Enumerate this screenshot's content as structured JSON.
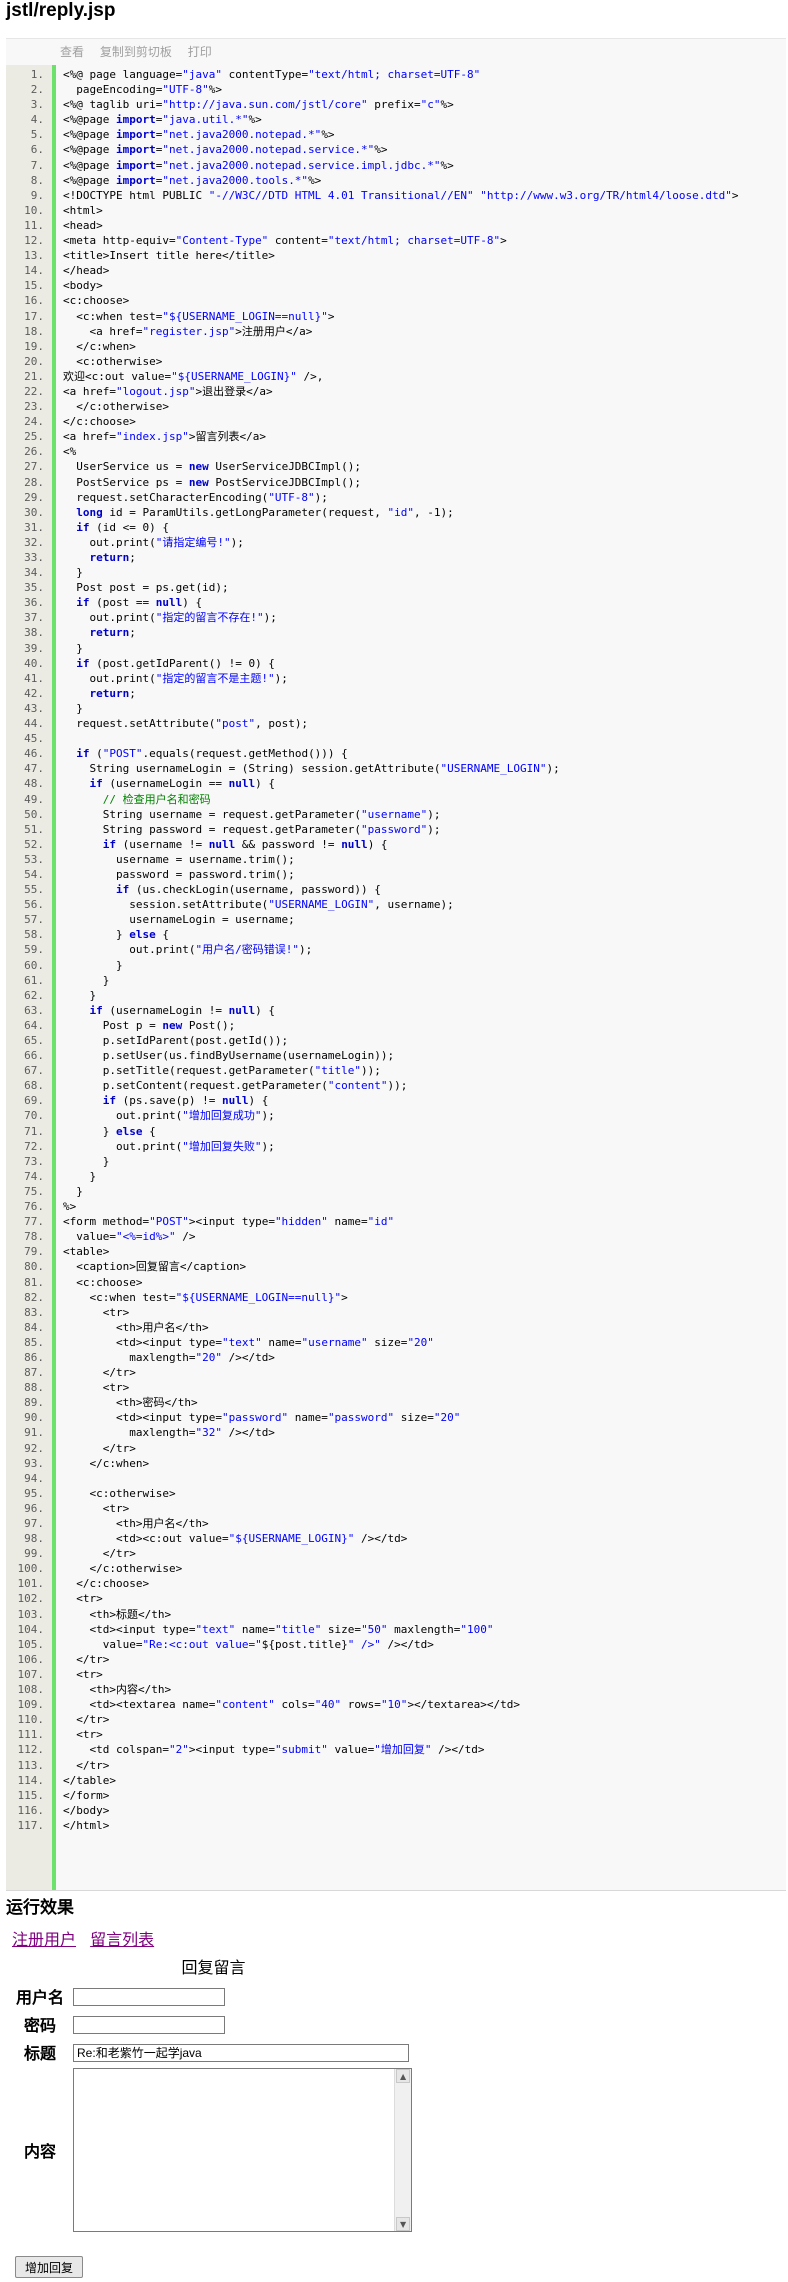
{
  "page_title": "jstl/reply.jsp",
  "toolbar": {
    "view": "查看",
    "copy": "复制到剪切板",
    "print": "打印"
  },
  "code_lines": [
    [
      [
        "t",
        "<%@ page language="
      ],
      [
        "s",
        "\"java\""
      ],
      [
        "t",
        " contentType="
      ],
      [
        "s",
        "\"text/html; charset=UTF-8\""
      ]
    ],
    [
      [
        "t",
        "  pageEncoding="
      ],
      [
        "s",
        "\"UTF-8\""
      ],
      [
        "t",
        "%>"
      ]
    ],
    [
      [
        "t",
        "<%@ taglib uri="
      ],
      [
        "s",
        "\"http://java.sun.com/jstl/core\""
      ],
      [
        "t",
        " prefix="
      ],
      [
        "s",
        "\"c\""
      ],
      [
        "t",
        "%>"
      ]
    ],
    [
      [
        "t",
        "<%@page "
      ],
      [
        "k",
        "import"
      ],
      [
        "t",
        "="
      ],
      [
        "s",
        "\"java.util.*\""
      ],
      [
        "t",
        "%>"
      ]
    ],
    [
      [
        "t",
        "<%@page "
      ],
      [
        "k",
        "import"
      ],
      [
        "t",
        "="
      ],
      [
        "s",
        "\"net.java2000.notepad.*\""
      ],
      [
        "t",
        "%>"
      ]
    ],
    [
      [
        "t",
        "<%@page "
      ],
      [
        "k",
        "import"
      ],
      [
        "t",
        "="
      ],
      [
        "s",
        "\"net.java2000.notepad.service.*\""
      ],
      [
        "t",
        "%>"
      ]
    ],
    [
      [
        "t",
        "<%@page "
      ],
      [
        "k",
        "import"
      ],
      [
        "t",
        "="
      ],
      [
        "s",
        "\"net.java2000.notepad.service.impl.jdbc.*\""
      ],
      [
        "t",
        "%>"
      ]
    ],
    [
      [
        "t",
        "<%@page "
      ],
      [
        "k",
        "import"
      ],
      [
        "t",
        "="
      ],
      [
        "s",
        "\"net.java2000.tools.*\""
      ],
      [
        "t",
        "%>"
      ]
    ],
    [
      [
        "t",
        "<!DOCTYPE html PUBLIC "
      ],
      [
        "s",
        "\"-//W3C//DTD HTML 4.01 Transitional//EN\""
      ],
      [
        "t",
        " "
      ],
      [
        "s",
        "\"http://www.w3.org/TR/html4/loose.dtd\""
      ],
      [
        "t",
        ">"
      ]
    ],
    [
      [
        "t",
        "<html>"
      ]
    ],
    [
      [
        "t",
        "<head>"
      ]
    ],
    [
      [
        "t",
        "<meta http-equiv="
      ],
      [
        "s",
        "\"Content-Type\""
      ],
      [
        "t",
        " content="
      ],
      [
        "s",
        "\"text/html; charset=UTF-8\""
      ],
      [
        "t",
        ">"
      ]
    ],
    [
      [
        "t",
        "<title>Insert title here</title>"
      ]
    ],
    [
      [
        "t",
        "</head>"
      ]
    ],
    [
      [
        "t",
        "<body>"
      ]
    ],
    [
      [
        "t",
        "<c:choose>"
      ]
    ],
    [
      [
        "t",
        "  <c:when test="
      ],
      [
        "s",
        "\"${USERNAME_LOGIN==null}\""
      ],
      [
        "t",
        ">"
      ]
    ],
    [
      [
        "t",
        "    <a href="
      ],
      [
        "s",
        "\"register.jsp\""
      ],
      [
        "t",
        ">注册用户</a>"
      ]
    ],
    [
      [
        "t",
        "  </c:when>"
      ]
    ],
    [
      [
        "t",
        "  <c:otherwise>"
      ]
    ],
    [
      [
        "t",
        "欢迎<c:out value="
      ],
      [
        "s",
        "\"${USERNAME_LOGIN}\""
      ],
      [
        "t",
        " />,"
      ]
    ],
    [
      [
        "t",
        "<a href="
      ],
      [
        "s",
        "\"logout.jsp\""
      ],
      [
        "t",
        ">退出登录</a>"
      ]
    ],
    [
      [
        "t",
        "  </c:otherwise>"
      ]
    ],
    [
      [
        "t",
        "</c:choose>"
      ]
    ],
    [
      [
        "t",
        "<a href="
      ],
      [
        "s",
        "\"index.jsp\""
      ],
      [
        "t",
        ">留言列表</a>"
      ]
    ],
    [
      [
        "t",
        "<%"
      ]
    ],
    [
      [
        "t",
        "  UserService us = "
      ],
      [
        "k",
        "new"
      ],
      [
        "t",
        " UserServiceJDBCImpl();"
      ]
    ],
    [
      [
        "t",
        "  PostService ps = "
      ],
      [
        "k",
        "new"
      ],
      [
        "t",
        " PostServiceJDBCImpl();"
      ]
    ],
    [
      [
        "t",
        "  request.setCharacterEncoding("
      ],
      [
        "s",
        "\"UTF-8\""
      ],
      [
        "t",
        ");"
      ]
    ],
    [
      [
        "t",
        "  "
      ],
      [
        "k",
        "long"
      ],
      [
        "t",
        " id = ParamUtils.getLongParameter(request, "
      ],
      [
        "s",
        "\"id\""
      ],
      [
        "t",
        ", -1);"
      ]
    ],
    [
      [
        "t",
        "  "
      ],
      [
        "k",
        "if"
      ],
      [
        "t",
        " (id <= 0) {"
      ]
    ],
    [
      [
        "t",
        "    out.print("
      ],
      [
        "s",
        "\"请指定编号!\""
      ],
      [
        "t",
        ");"
      ]
    ],
    [
      [
        "t",
        "    "
      ],
      [
        "k",
        "return"
      ],
      [
        "t",
        ";"
      ]
    ],
    [
      [
        "t",
        "  }"
      ]
    ],
    [
      [
        "t",
        "  Post post = ps.get(id);"
      ]
    ],
    [
      [
        "t",
        "  "
      ],
      [
        "k",
        "if"
      ],
      [
        "t",
        " (post == "
      ],
      [
        "k",
        "null"
      ],
      [
        "t",
        ") {"
      ]
    ],
    [
      [
        "t",
        "    out.print("
      ],
      [
        "s",
        "\"指定的留言不存在!\""
      ],
      [
        "t",
        ");"
      ]
    ],
    [
      [
        "t",
        "    "
      ],
      [
        "k",
        "return"
      ],
      [
        "t",
        ";"
      ]
    ],
    [
      [
        "t",
        "  }"
      ]
    ],
    [
      [
        "t",
        "  "
      ],
      [
        "k",
        "if"
      ],
      [
        "t",
        " (post.getIdParent() != 0) {"
      ]
    ],
    [
      [
        "t",
        "    out.print("
      ],
      [
        "s",
        "\"指定的留言不是主题!\""
      ],
      [
        "t",
        ");"
      ]
    ],
    [
      [
        "t",
        "    "
      ],
      [
        "k",
        "return"
      ],
      [
        "t",
        ";"
      ]
    ],
    [
      [
        "t",
        "  }"
      ]
    ],
    [
      [
        "t",
        "  request.setAttribute("
      ],
      [
        "s",
        "\"post\""
      ],
      [
        "t",
        ", post);"
      ]
    ],
    [
      [
        "t",
        ""
      ]
    ],
    [
      [
        "t",
        "  "
      ],
      [
        "k",
        "if"
      ],
      [
        "t",
        " ("
      ],
      [
        "s",
        "\"POST\""
      ],
      [
        "t",
        ".equals(request.getMethod())) {"
      ]
    ],
    [
      [
        "t",
        "    String usernameLogin = (String) session.getAttribute("
      ],
      [
        "s",
        "\"USERNAME_LOGIN\""
      ],
      [
        "t",
        ");"
      ]
    ],
    [
      [
        "t",
        "    "
      ],
      [
        "k",
        "if"
      ],
      [
        "t",
        " (usernameLogin == "
      ],
      [
        "k",
        "null"
      ],
      [
        "t",
        ") {"
      ]
    ],
    [
      [
        "t",
        "      "
      ],
      [
        "c",
        "// 检查用户名和密码"
      ]
    ],
    [
      [
        "t",
        "      String username = request.getParameter("
      ],
      [
        "s",
        "\"username\""
      ],
      [
        "t",
        ");"
      ]
    ],
    [
      [
        "t",
        "      String password = request.getParameter("
      ],
      [
        "s",
        "\"password\""
      ],
      [
        "t",
        ");"
      ]
    ],
    [
      [
        "t",
        "      "
      ],
      [
        "k",
        "if"
      ],
      [
        "t",
        " (username != "
      ],
      [
        "k",
        "null"
      ],
      [
        "t",
        " && password != "
      ],
      [
        "k",
        "null"
      ],
      [
        "t",
        ") {"
      ]
    ],
    [
      [
        "t",
        "        username = username.trim();"
      ]
    ],
    [
      [
        "t",
        "        password = password.trim();"
      ]
    ],
    [
      [
        "t",
        "        "
      ],
      [
        "k",
        "if"
      ],
      [
        "t",
        " (us.checkLogin(username, password)) {"
      ]
    ],
    [
      [
        "t",
        "          session.setAttribute("
      ],
      [
        "s",
        "\"USERNAME_LOGIN\""
      ],
      [
        "t",
        ", username);"
      ]
    ],
    [
      [
        "t",
        "          usernameLogin = username;"
      ]
    ],
    [
      [
        "t",
        "        } "
      ],
      [
        "k",
        "else"
      ],
      [
        "t",
        " {"
      ]
    ],
    [
      [
        "t",
        "          out.print("
      ],
      [
        "s",
        "\"用户名/密码错误!\""
      ],
      [
        "t",
        ");"
      ]
    ],
    [
      [
        "t",
        "        }"
      ]
    ],
    [
      [
        "t",
        "      }"
      ]
    ],
    [
      [
        "t",
        "    }"
      ]
    ],
    [
      [
        "t",
        "    "
      ],
      [
        "k",
        "if"
      ],
      [
        "t",
        " (usernameLogin != "
      ],
      [
        "k",
        "null"
      ],
      [
        "t",
        ") {"
      ]
    ],
    [
      [
        "t",
        "      Post p = "
      ],
      [
        "k",
        "new"
      ],
      [
        "t",
        " Post();"
      ]
    ],
    [
      [
        "t",
        "      p.setIdParent(post.getId());"
      ]
    ],
    [
      [
        "t",
        "      p.setUser(us.findByUsername(usernameLogin));"
      ]
    ],
    [
      [
        "t",
        "      p.setTitle(request.getParameter("
      ],
      [
        "s",
        "\"title\""
      ],
      [
        "t",
        "));"
      ]
    ],
    [
      [
        "t",
        "      p.setContent(request.getParameter("
      ],
      [
        "s",
        "\"content\""
      ],
      [
        "t",
        "));"
      ]
    ],
    [
      [
        "t",
        "      "
      ],
      [
        "k",
        "if"
      ],
      [
        "t",
        " (ps.save(p) != "
      ],
      [
        "k",
        "null"
      ],
      [
        "t",
        ") {"
      ]
    ],
    [
      [
        "t",
        "        out.print("
      ],
      [
        "s",
        "\"增加回复成功\""
      ],
      [
        "t",
        ");"
      ]
    ],
    [
      [
        "t",
        "      } "
      ],
      [
        "k",
        "else"
      ],
      [
        "t",
        " {"
      ]
    ],
    [
      [
        "t",
        "        out.print("
      ],
      [
        "s",
        "\"增加回复失败\""
      ],
      [
        "t",
        ");"
      ]
    ],
    [
      [
        "t",
        "      }"
      ]
    ],
    [
      [
        "t",
        "    }"
      ]
    ],
    [
      [
        "t",
        "  }"
      ]
    ],
    [
      [
        "t",
        "%>"
      ]
    ],
    [
      [
        "t",
        "<form method="
      ],
      [
        "s",
        "\"POST\""
      ],
      [
        "t",
        "><input type="
      ],
      [
        "s",
        "\"hidden\""
      ],
      [
        "t",
        " name="
      ],
      [
        "s",
        "\"id\""
      ]
    ],
    [
      [
        "t",
        "  value="
      ],
      [
        "s",
        "\"<%=id%>\""
      ],
      [
        "t",
        " />"
      ]
    ],
    [
      [
        "t",
        "<table>"
      ]
    ],
    [
      [
        "t",
        "  <caption>回复留言</caption>"
      ]
    ],
    [
      [
        "t",
        "  <c:choose>"
      ]
    ],
    [
      [
        "t",
        "    <c:when test="
      ],
      [
        "s",
        "\"${USERNAME_LOGIN==null}\""
      ],
      [
        "t",
        ">"
      ]
    ],
    [
      [
        "t",
        "      <tr>"
      ]
    ],
    [
      [
        "t",
        "        <th>用户名</th>"
      ]
    ],
    [
      [
        "t",
        "        <td><input type="
      ],
      [
        "s",
        "\"text\""
      ],
      [
        "t",
        " name="
      ],
      [
        "s",
        "\"username\""
      ],
      [
        "t",
        " size="
      ],
      [
        "s",
        "\"20\""
      ]
    ],
    [
      [
        "t",
        "          maxlength="
      ],
      [
        "s",
        "\"20\""
      ],
      [
        "t",
        " /></td>"
      ]
    ],
    [
      [
        "t",
        "      </tr>"
      ]
    ],
    [
      [
        "t",
        "      <tr>"
      ]
    ],
    [
      [
        "t",
        "        <th>密码</th>"
      ]
    ],
    [
      [
        "t",
        "        <td><input type="
      ],
      [
        "s",
        "\"password\""
      ],
      [
        "t",
        " name="
      ],
      [
        "s",
        "\"password\""
      ],
      [
        "t",
        " size="
      ],
      [
        "s",
        "\"20\""
      ]
    ],
    [
      [
        "t",
        "          maxlength="
      ],
      [
        "s",
        "\"32\""
      ],
      [
        "t",
        " /></td>"
      ]
    ],
    [
      [
        "t",
        "      </tr>"
      ]
    ],
    [
      [
        "t",
        "    </c:when>"
      ]
    ],
    [
      [
        "t",
        ""
      ]
    ],
    [
      [
        "t",
        "    <c:otherwise>"
      ]
    ],
    [
      [
        "t",
        "      <tr>"
      ]
    ],
    [
      [
        "t",
        "        <th>用户名</th>"
      ]
    ],
    [
      [
        "t",
        "        <td><c:out value="
      ],
      [
        "s",
        "\"${USERNAME_LOGIN}\""
      ],
      [
        "t",
        " /></td>"
      ]
    ],
    [
      [
        "t",
        "      </tr>"
      ]
    ],
    [
      [
        "t",
        "    </c:otherwise>"
      ]
    ],
    [
      [
        "t",
        "  </c:choose>"
      ]
    ],
    [
      [
        "t",
        "  <tr>"
      ]
    ],
    [
      [
        "t",
        "    <th>标题</th>"
      ]
    ],
    [
      [
        "t",
        "    <td><input type="
      ],
      [
        "s",
        "\"text\""
      ],
      [
        "t",
        " name="
      ],
      [
        "s",
        "\"title\""
      ],
      [
        "t",
        " size="
      ],
      [
        "s",
        "\"50\""
      ],
      [
        "t",
        " maxlength="
      ],
      [
        "s",
        "\"100\""
      ]
    ],
    [
      [
        "t",
        "      value="
      ],
      [
        "s",
        "\"Re:<c:out value=\""
      ],
      [
        "t",
        "${post.title}"
      ],
      [
        "s",
        "\" />\""
      ],
      [
        "t",
        " /></td>"
      ]
    ],
    [
      [
        "t",
        "  </tr>"
      ]
    ],
    [
      [
        "t",
        "  <tr>"
      ]
    ],
    [
      [
        "t",
        "    <th>内容</th>"
      ]
    ],
    [
      [
        "t",
        "    <td><textarea name="
      ],
      [
        "s",
        "\"content\""
      ],
      [
        "t",
        " cols="
      ],
      [
        "s",
        "\"40\""
      ],
      [
        "t",
        " rows="
      ],
      [
        "s",
        "\"10\""
      ],
      [
        "t",
        "></textarea></td>"
      ]
    ],
    [
      [
        "t",
        "  </tr>"
      ]
    ],
    [
      [
        "t",
        "  <tr>"
      ]
    ],
    [
      [
        "t",
        "    <td colspan="
      ],
      [
        "s",
        "\"2\""
      ],
      [
        "t",
        "><input type="
      ],
      [
        "s",
        "\"submit\""
      ],
      [
        "t",
        " value="
      ],
      [
        "s",
        "\"增加回复\""
      ],
      [
        "t",
        " /></td>"
      ]
    ],
    [
      [
        "t",
        "  </tr>"
      ]
    ],
    [
      [
        "t",
        "</table>"
      ]
    ],
    [
      [
        "t",
        "</form>"
      ]
    ],
    [
      [
        "t",
        "</body>"
      ]
    ],
    [
      [
        "t",
        "</html>"
      ]
    ]
  ],
  "result": {
    "heading": "运行效果",
    "link_register": "注册用户",
    "link_list": "留言列表",
    "caption": "回复留言",
    "label_username": "用户名",
    "label_password": "密码",
    "label_title": "标题",
    "label_content": "内容",
    "username_value": "",
    "password_value": "",
    "title_value": "Re:和老紫竹一起学java",
    "content_value": "",
    "submit_label": "增加回复"
  },
  "colors": {
    "keyword": "#0000cc",
    "string": "#0000ff",
    "comment": "#008200",
    "gutter": "#ebebe3",
    "gutter_accent": "#6ce26c",
    "link_visited": "#800080"
  }
}
